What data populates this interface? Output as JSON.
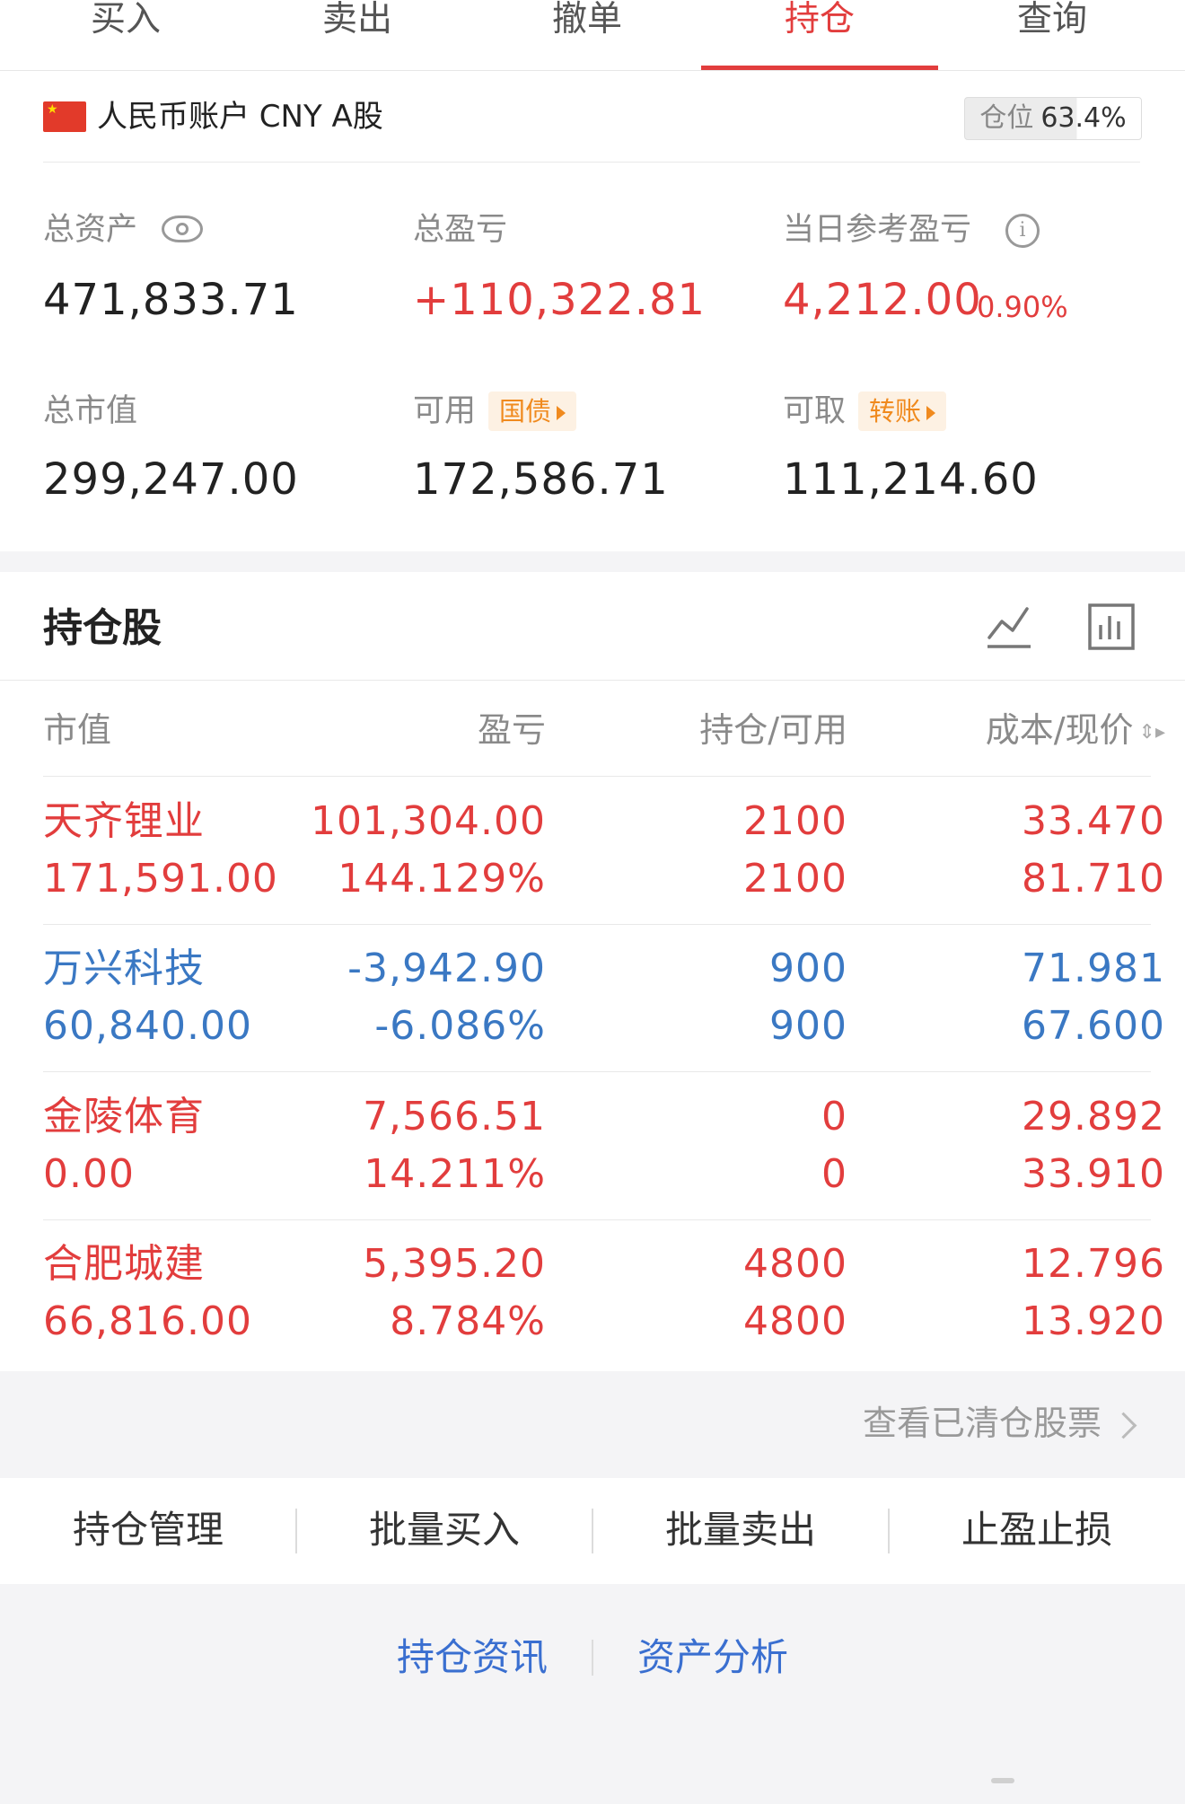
{
  "tabs": [
    {
      "label": "买入"
    },
    {
      "label": "卖出"
    },
    {
      "label": "撤单"
    },
    {
      "label": "持仓"
    },
    {
      "label": "查询"
    }
  ],
  "active_tab": "持仓",
  "account": {
    "name": "人民币账户 CNY A股",
    "position_label": "仓位",
    "position_value": "63.4%",
    "position_fraction": 0.634,
    "flag_icon": "china-flag-icon"
  },
  "stats": {
    "total_assets_label": "总资产",
    "total_assets": "471,833.71",
    "total_pnl_label": "总盈亏",
    "total_pnl": "+110,322.81",
    "daily_pnl_label": "当日参考盈亏",
    "daily_pnl": "4,212.00",
    "daily_pnl_pct": "0.90%",
    "market_value_label": "总市值",
    "market_value": "299,247.00",
    "available_label": "可用",
    "available_pill": "国债",
    "available": "172,586.71",
    "withdrawable_label": "可取",
    "withdrawable_pill": "转账",
    "withdrawable": "111,214.60"
  },
  "holdings": {
    "title": "持仓股",
    "headers": {
      "market_value": "市值",
      "pnl": "盈亏",
      "position": "持仓/可用",
      "cost_price": "成本/现价"
    },
    "rows": [
      {
        "name": "天齐锂业",
        "value": "171,591.00",
        "pnl": "101,304.00",
        "pnl_pct": "144.129%",
        "hold": "2100",
        "avail": "2100",
        "cost": "33.470",
        "price": "81.710",
        "trend": "up"
      },
      {
        "name": "万兴科技",
        "value": "60,840.00",
        "pnl": "-3,942.90",
        "pnl_pct": "-6.086%",
        "hold": "900",
        "avail": "900",
        "cost": "71.981",
        "price": "67.600",
        "trend": "down"
      },
      {
        "name": "金陵体育",
        "value": "0.00",
        "pnl": "7,566.51",
        "pnl_pct": "14.211%",
        "hold": "0",
        "avail": "0",
        "cost": "29.892",
        "price": "33.910",
        "trend": "up"
      },
      {
        "name": "合肥城建",
        "value": "66,816.00",
        "pnl": "5,395.20",
        "pnl_pct": "8.784%",
        "hold": "4800",
        "avail": "4800",
        "cost": "12.796",
        "price": "13.920",
        "trend": "up"
      }
    ],
    "cleared_link": "查看已清仓股票"
  },
  "actions": [
    {
      "label": "持仓管理"
    },
    {
      "label": "批量买入"
    },
    {
      "label": "批量卖出"
    },
    {
      "label": "止盈止损"
    }
  ],
  "bottom_links": [
    {
      "label": "持仓资讯"
    },
    {
      "label": "资产分析"
    }
  ],
  "colors": {
    "accent_red": "#e23d3d",
    "down_blue": "#3a78c3",
    "link_blue": "#3a6fd0",
    "pill_orange": "#f08a1e"
  }
}
